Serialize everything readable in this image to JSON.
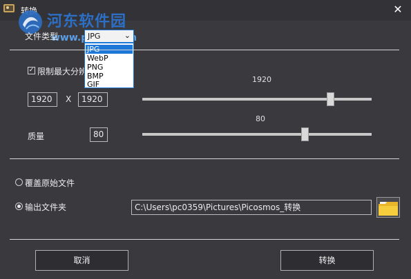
{
  "window": {
    "title": "转换",
    "close_glyph": "✕",
    "app_icon": "app-icon",
    "close_icon": "close-icon"
  },
  "watermark": {
    "text": "河东软件园",
    "url": "www.pc0359.cn"
  },
  "file_type": {
    "label": "文件类型",
    "selected": "JPG",
    "options": [
      "JPG",
      "WebP",
      "PNG",
      "BMP",
      "GIF"
    ],
    "chevron_icon": "chevron-down-icon"
  },
  "resolution": {
    "checkbox_label": "限制最大分辨率",
    "checked": true,
    "width": "1920",
    "separator": "X",
    "height": "1920",
    "slider_value": "1920",
    "slider_fraction": 0.82
  },
  "quality": {
    "label": "质量",
    "value": "80",
    "slider_value": "80",
    "slider_fraction": 0.71
  },
  "output": {
    "overwrite_label": "覆盖原始文件",
    "overwrite_selected": false,
    "folder_label": "输出文件夹",
    "folder_selected": true,
    "path": "C:\\Users\\pc0359\\Pictures\\Picosmos_转换",
    "folder_icon": "folder-icon"
  },
  "buttons": {
    "cancel": "取消",
    "convert": "转换"
  },
  "colors": {
    "background": "#3a393e",
    "accent": "#1e78d7",
    "watermark": "#2c6fc4"
  }
}
